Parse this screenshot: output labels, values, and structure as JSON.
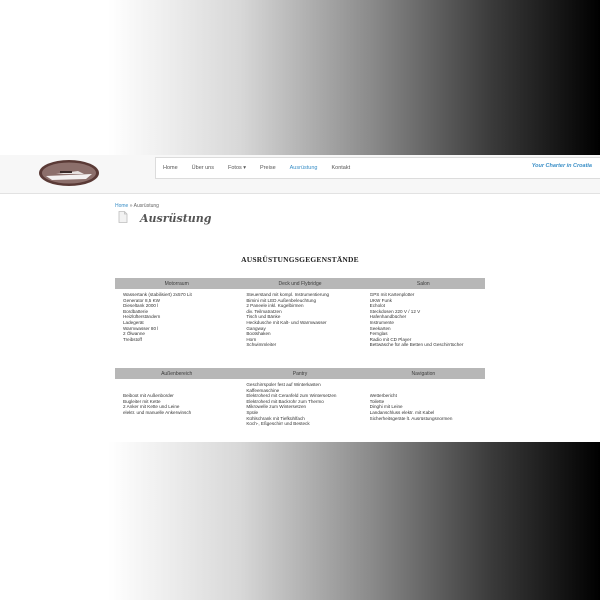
{
  "header": {
    "nav": [
      "Home",
      "Über uns",
      "Fotos ▾",
      "Preise",
      "Ausrüstung",
      "Kontakt"
    ],
    "active_index": 4,
    "tagline": "Your Charter in Croatia"
  },
  "breadcrumb": {
    "home": "Home",
    "sep": " » ",
    "current": "Ausrüstung"
  },
  "page_title": "Ausrüstung",
  "section_title": "AUSRÜSTUNGSGEGENSTÄNDE",
  "table1": {
    "headers": [
      "Motorraum",
      "Deck und Flybridge",
      "Salon"
    ],
    "col1": [
      "Wassertank (stabilisiert) 2x570 Lit",
      "Generator 8,5 KW",
      "Dieseltank 2000 l",
      "Bordbatterie",
      "Heizlüfterständern",
      "Ladegerät",
      "Warmwasser 80 l",
      "2 Ölwanne",
      "Treibstoff"
    ],
    "col2": [
      "Steuerstand mit kompl. Instrumentierung",
      "Bimini mit LED Außenbeleuchtung",
      "2 Paneele inkl. Kugelbirmen",
      "div. Teilmatratzen",
      "Tisch und Bänke",
      "Heckdusche mit Kalt- und Warmwasser",
      "Gangway",
      "Bootshaken",
      "Horn",
      "Schwimmleiter"
    ],
    "col3": [
      "GPS mit Kartenplotter",
      "UKW Funk",
      "Echolot",
      "Steckdosen 220 V / 12 V",
      "Hafenhandbücher",
      "Instrumente",
      "Seekarten",
      "Fernglas",
      "Radio mit CD Player",
      "Bettwäsche für alle Betten und Geschirrtücher"
    ]
  },
  "table2": {
    "headers": [
      "Außenbereich",
      "Pantry",
      "Navigation"
    ],
    "col1": [
      "Beiboot mit Außenborder",
      "Bugleiter mit Kette",
      "2 Anker mit Kette und Leine",
      "elektr. und manuelle Ankerwinsch"
    ],
    "col2": [
      "Geschirrspüler fest auf Winterkasten",
      "Kaffeemaschine",
      "Elektroherd mit Ceranfeld zum Wintersetzen",
      "Elektroherd mit Backrohr zum Thermo",
      "Mikrowelle zum Wintersetzen",
      "Spüle",
      "Kühlschrank mit Tiefkühlfach",
      "Koch-, Eßgeschirr und Besteck"
    ],
    "col3": [
      "",
      "Wetterbericht",
      "Toilette",
      "Dinghi mit Leine",
      "Landanschluss elektr. mit Kabel",
      "Sicherheitsgeräte lt. Ausrüstungsnormen"
    ]
  }
}
